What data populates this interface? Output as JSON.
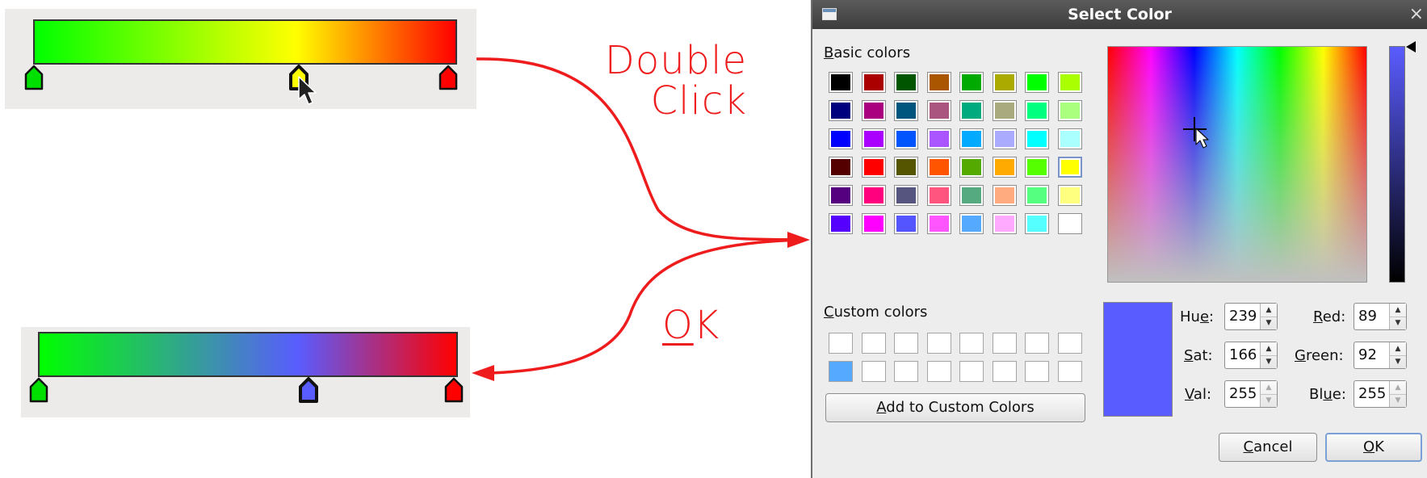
{
  "annotations": {
    "double_click_line1": "Double",
    "double_click_line2": "Click",
    "ok_label_u": "O",
    "ok_label_rest": "K"
  },
  "gradient_before": {
    "stops": [
      "#00ff00",
      "#ffff00",
      "#ff0000"
    ]
  },
  "gradient_after": {
    "stops": [
      "#00ff00",
      "#595cff",
      "#ff0000"
    ]
  },
  "dialog": {
    "title": "Select Color",
    "basic_colors_label_u": "B",
    "basic_colors_label_rest": "asic colors",
    "basic_colors": [
      [
        "#000000",
        "#aa0000",
        "#005500",
        "#aa5500",
        "#00aa00",
        "#aaaa00",
        "#00ff00",
        "#aaff00"
      ],
      [
        "#00007f",
        "#aa007f",
        "#00557f",
        "#aa557f",
        "#00aa7f",
        "#aaaa7f",
        "#00ff7f",
        "#aaff7f"
      ],
      [
        "#0000ff",
        "#aa00ff",
        "#0055ff",
        "#aa55ff",
        "#00aaff",
        "#aaaaff",
        "#00ffff",
        "#aaffff"
      ],
      [
        "#550000",
        "#ff0000",
        "#555500",
        "#ff5500",
        "#55aa00",
        "#ffaa00",
        "#55ff00",
        "#ffff00"
      ],
      [
        "#55007f",
        "#ff007f",
        "#55557f",
        "#ff557f",
        "#55aa7f",
        "#ffaa7f",
        "#55ff7f",
        "#ffff7f"
      ],
      [
        "#5500ff",
        "#ff00ff",
        "#5555ff",
        "#ff55ff",
        "#55aaff",
        "#ffaaff",
        "#55ffff",
        "#ffffff"
      ]
    ],
    "custom_colors_label_u": "C",
    "custom_colors_label_rest": "ustom colors",
    "custom_colors": [
      [
        "#ffffff",
        "#ffffff",
        "#ffffff",
        "#ffffff",
        "#ffffff",
        "#ffffff",
        "#ffffff",
        "#ffffff"
      ],
      [
        "#55aaff",
        "#ffffff",
        "#ffffff",
        "#ffffff",
        "#ffffff",
        "#ffffff",
        "#ffffff",
        "#ffffff"
      ]
    ],
    "add_custom_pre": "",
    "add_custom_u": "A",
    "add_custom_rest": "dd to Custom Colors",
    "selected_color": "#595cff",
    "fields": {
      "hue": {
        "label_pre": "Hu",
        "label_u": "e",
        "label_post": ":",
        "value": "239"
      },
      "sat": {
        "label_pre": "",
        "label_u": "S",
        "label_post": "at:",
        "value": "166"
      },
      "val": {
        "label_pre": "",
        "label_u": "V",
        "label_post": "al:",
        "value": "255"
      },
      "red": {
        "label_pre": "",
        "label_u": "R",
        "label_post": "ed:",
        "value": "89"
      },
      "green": {
        "label_pre": "",
        "label_u": "G",
        "label_post": "reen:",
        "value": "92"
      },
      "blue": {
        "label_pre": "Bl",
        "label_u": "u",
        "label_post": "e:",
        "value": "255"
      }
    },
    "cancel_u": "C",
    "cancel_rest": "ancel",
    "ok_u": "O",
    "ok_rest": "K",
    "close_glyph": "×"
  }
}
